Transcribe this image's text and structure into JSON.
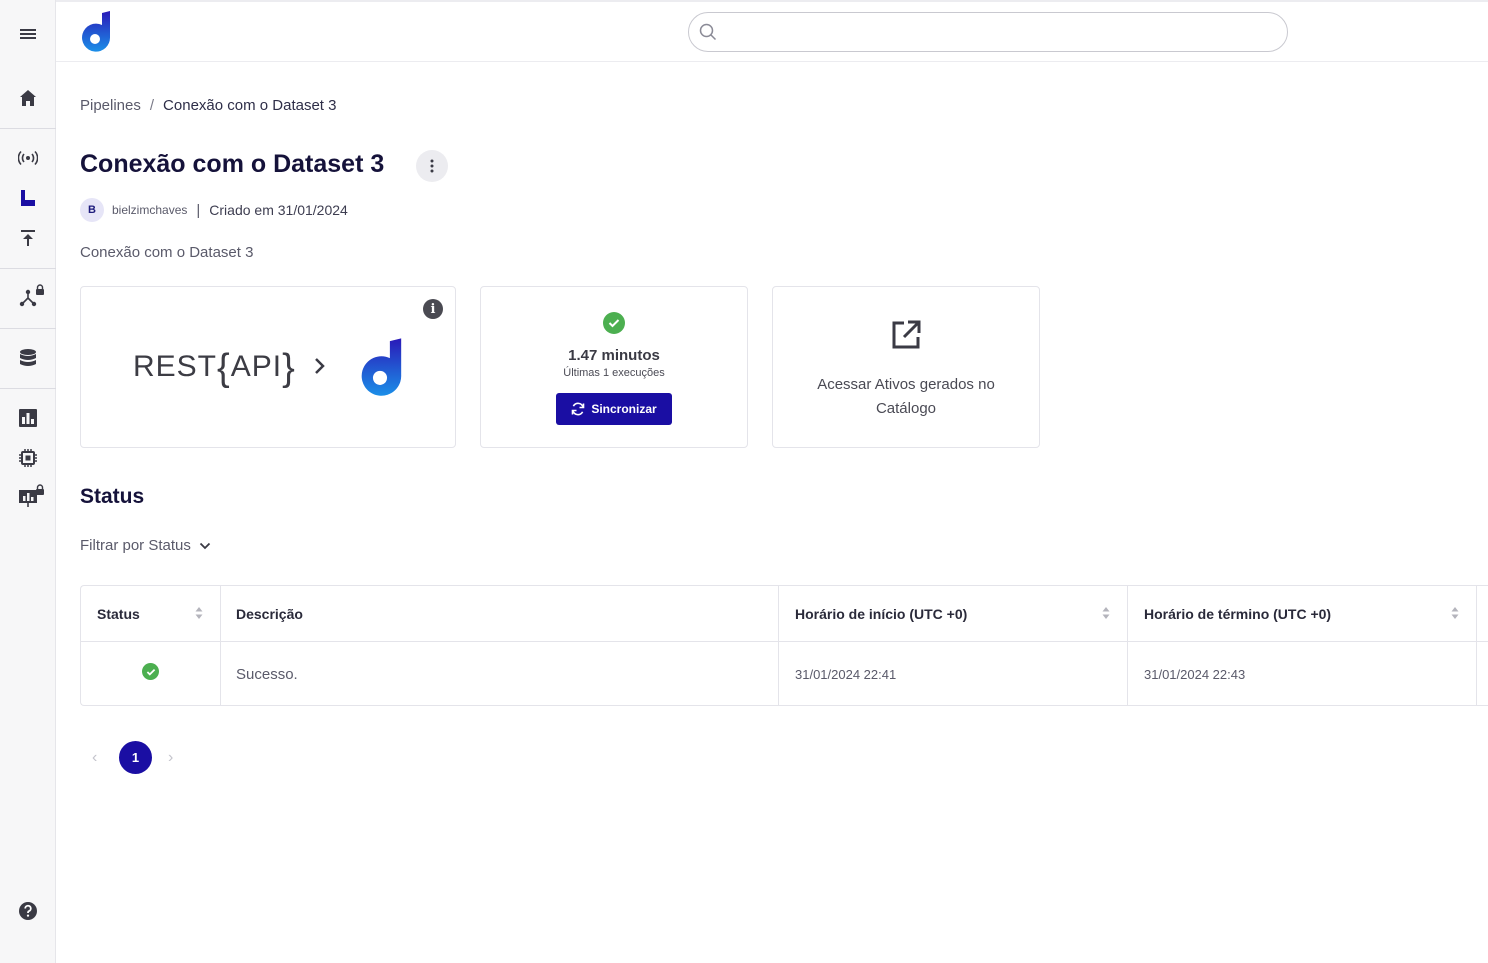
{
  "sidebar": {
    "items": [
      {
        "icon": "menu-icon"
      },
      {
        "icon": "home-icon"
      },
      {
        "icon": "broadcast-icon"
      },
      {
        "icon": "pipeline-icon",
        "active": true
      },
      {
        "icon": "upload-icon"
      },
      {
        "icon": "graph-icon",
        "locked": true
      },
      {
        "icon": "database-icon"
      },
      {
        "icon": "bar-chart-icon"
      },
      {
        "icon": "chip-icon"
      },
      {
        "icon": "presentation-icon",
        "locked": true
      },
      {
        "icon": "help-icon"
      }
    ]
  },
  "header": {
    "logo": "d-logo",
    "search": {
      "placeholder": "",
      "value": ""
    }
  },
  "breadcrumb": {
    "root": "Pipelines",
    "separator": "/",
    "current": "Conexão com o Dataset 3"
  },
  "page": {
    "title": "Conexão com o Dataset 3",
    "avatar_initial": "B",
    "username": "bielzimchaves",
    "separator": "|",
    "created": "Criado em 31/01/2024",
    "description": "Conexão com o Dataset 3"
  },
  "cards": {
    "connection": {
      "source_prefix": "REST",
      "source_brace_open": "{",
      "source_name": "API",
      "source_brace_close": "}",
      "info_label": "i"
    },
    "sync": {
      "duration": "1.47 minutos",
      "executions": "Últimas 1 execuções",
      "button_label": "Sincronizar"
    },
    "catalog": {
      "label": "Acessar Ativos gerados no Catálogo"
    }
  },
  "status_section": {
    "title": "Status",
    "filter_label": "Filtrar por Status"
  },
  "table": {
    "columns": [
      "Status",
      "Descrição",
      "Horário de início (UTC +0)",
      "Horário de término (UTC +0)"
    ],
    "rows": [
      {
        "status": "success",
        "description": "Sucesso.",
        "start": "31/01/2024 22:41",
        "end": "31/01/2024 22:43"
      }
    ]
  },
  "pagination": {
    "prev": "‹",
    "current_page": "1",
    "next": "›"
  },
  "colors": {
    "primary": "#1a0ea3",
    "success": "#4caf50",
    "title": "#15123a"
  }
}
